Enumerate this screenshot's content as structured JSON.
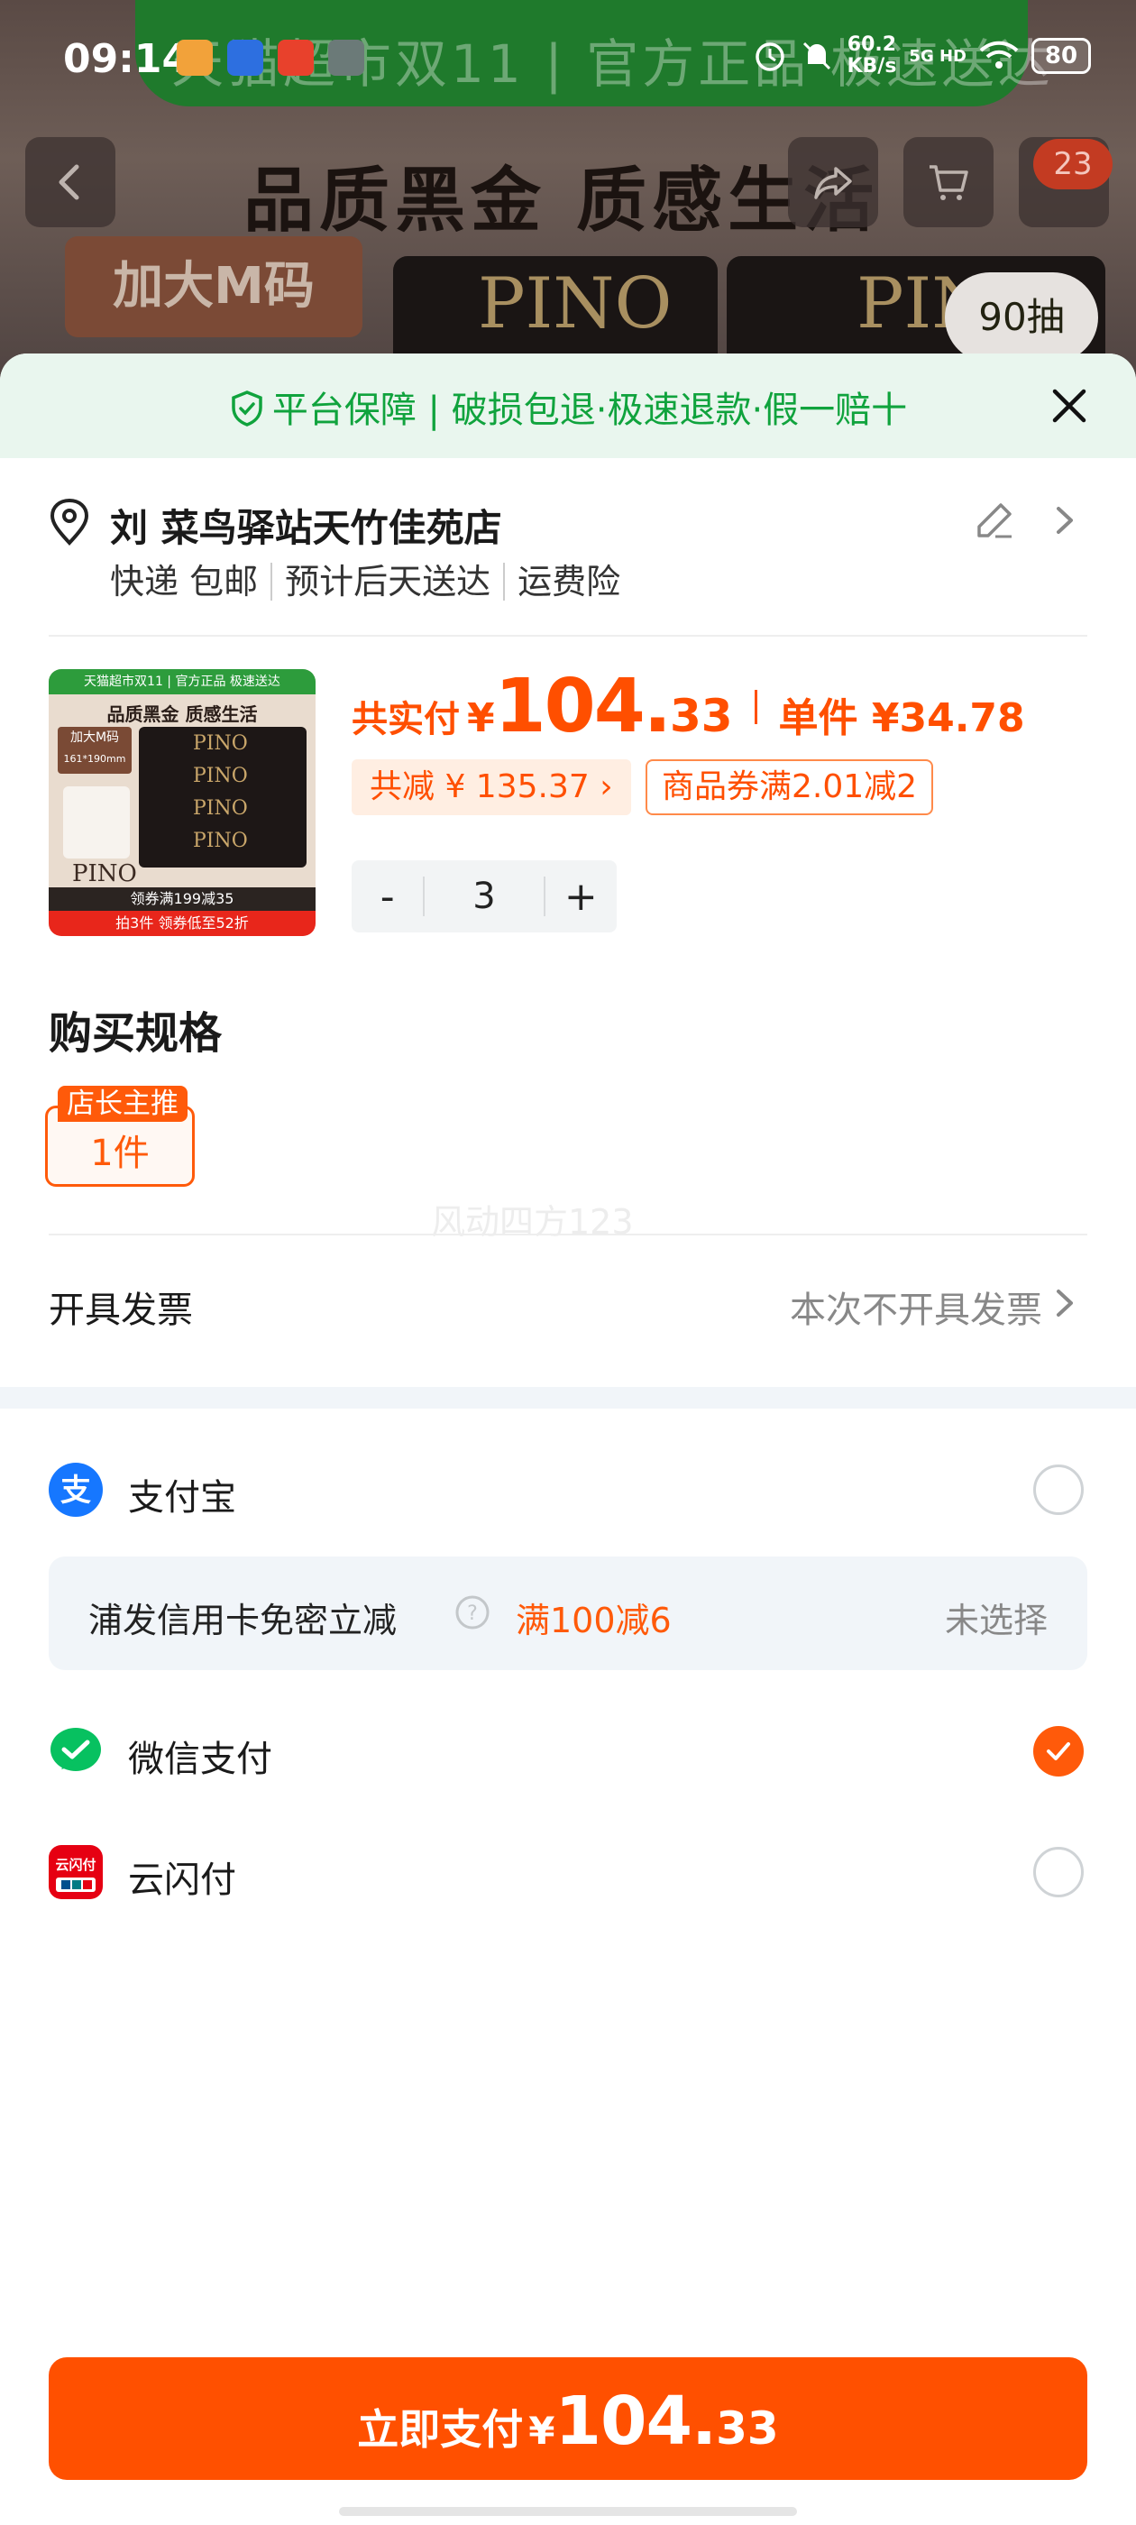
{
  "status_bar": {
    "time": "09:14",
    "net_speed": "60.2",
    "net_unit": "KB/s",
    "signal": "5G HD",
    "battery": "80"
  },
  "background": {
    "banner": "天猫超市双11 | 官方正品 极速送达",
    "slogan": "品质黑金 质感生活",
    "tag": "加大M码",
    "brand": "PINO",
    "sheets_badge": "90抽",
    "cart_badge": "23"
  },
  "sheet": {
    "guarantee": "平台保障 | 破损包退·极速退款·假一赔十",
    "address": {
      "name": "刘 菜鸟驿站天竹佳苑店",
      "tags": [
        "快递 包邮",
        "预计后天送达",
        "运费险"
      ]
    },
    "product": {
      "image": {
        "top": "天猫超市双11 | 官方正品 极速送达",
        "slogan": "品质黑金 质感生活",
        "tag": "加大M码",
        "tag_size": "161*190mm",
        "brand": "PINO",
        "coupon_line": "领券满199减35",
        "promo_line": "拍3件 领券低至52折"
      },
      "total_label": "共实付",
      "currency": "¥",
      "total_int": "104.",
      "total_dec": "33",
      "unit_price": "单件 ¥34.78",
      "saved": "共减 ¥ 135.37 ›",
      "coupon": "商品券满2.01减2",
      "quantity": "3",
      "minus": "-",
      "plus": "+"
    },
    "spec": {
      "title": "购买规格",
      "badge": "店长主推",
      "option": "1件"
    },
    "watermark": "风动四方123",
    "invoice": {
      "label": "开具发票",
      "value": "本次不开具发票"
    },
    "payment_methods": [
      {
        "label": "支付宝",
        "icon": "alipay-icon",
        "selected": false
      },
      {
        "label": "微信支付",
        "icon": "wechat-pay-icon",
        "selected": true
      },
      {
        "label": "云闪付",
        "icon": "unionpay-icon",
        "selected": false
      }
    ],
    "promo": {
      "label": "浦发信用卡免密立减",
      "offer": "满100减6",
      "status": "未选择"
    },
    "pay_button": {
      "label": "立即支付",
      "currency": "¥",
      "amount_int": "104.",
      "amount_dec": "33"
    }
  },
  "colors": {
    "accent": "#ff5000",
    "guarantee_green": "#10a33d",
    "alipay_blue": "#1677ff",
    "wechat_green": "#07c160",
    "unionpay_red": "#e60012"
  }
}
